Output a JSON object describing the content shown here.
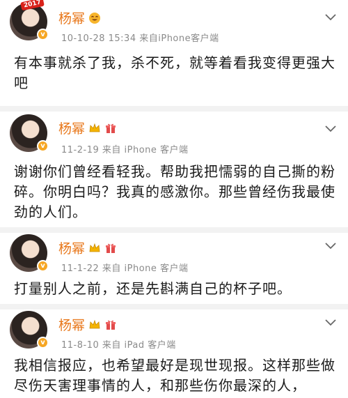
{
  "posts": [
    {
      "user": "杨幂",
      "avatar_tag": "2017",
      "meta": "10-10-28 15:34  来自iPhone客户端",
      "content": "有本事就杀了我，杀不死，就等着看我变得更强大吧"
    },
    {
      "user": "杨幂",
      "meta": "11-2-19  来自 iPhone 客户端",
      "content": "谢谢你们曾经看轻我。帮助我把懦弱的自己撕的粉碎。你明白吗？我真的感激你。那些曾经伤我最使劲的人们。"
    },
    {
      "user": "杨幂",
      "meta": "11-1-22  来自 iPhone 客户端",
      "content": "打量别人之前，还是先斟满自己的杯子吧。"
    },
    {
      "user": "杨幂",
      "meta": "11-8-10  来自 iPad 客户端",
      "content": "我相信报应，也希望最好是现世现报。这样那些做尽伤天害理事情的人，和那些伤你最深的人，"
    }
  ],
  "icons": {
    "verified_badge": "v",
    "accent": "#e8771a",
    "badge_color": "#f6a623"
  }
}
